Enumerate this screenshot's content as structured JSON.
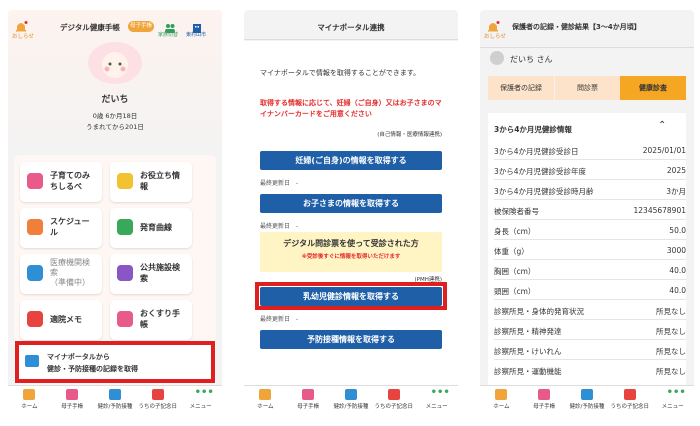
{
  "colors": {
    "accent_orange": "#f0a53a",
    "brand_blue": "#1f5fa8",
    "alert_red": "#e52b2b",
    "tab_active": "#f5a623"
  },
  "screen1": {
    "notice_label": "おしらせ",
    "title": "デジタル健康手帳",
    "child_badge": "母子手帳",
    "family_label": "家族切替",
    "city_label": "東村山市",
    "child_name": "だいち",
    "age": "0歳 6か月18日",
    "days": "うまれてから201日",
    "menu": [
      {
        "label": "子育てのみ\nちしるべ",
        "icon": "bookmark-icon"
      },
      {
        "label": "お役立ち情\n報",
        "icon": "lightbulb-icon"
      },
      {
        "label": "スケジュー\nル",
        "icon": "calendar-icon"
      },
      {
        "label": "発育曲線",
        "icon": "bar-chart-icon"
      },
      {
        "label": "医療機関検\n索\n（準備中）",
        "icon": "hospital-icon"
      },
      {
        "label": "公共施設検\n索",
        "icon": "house-icon"
      },
      {
        "label": "適院メモ",
        "icon": "memo-icon"
      },
      {
        "label": "おくすり手\n帳",
        "icon": "pill-icon"
      }
    ],
    "mynaportal_line1": "マイナポータルから",
    "mynaportal_line2": "健診・予防接種の記録を取得"
  },
  "screen2": {
    "title": "マイナポータル連携",
    "intro": "マイナポータルで情報を取得することができます。",
    "warning": "取得する情報に応じて、妊婦（ご自身）又はお子さまのマイナンバーカードをご用意ください",
    "note": "(自己情報・医療情報連携)",
    "btn_pregnant": "妊婦(ご自身)の情報を取得する",
    "last_updated": "最終更新日　-",
    "btn_child": "お子さまの情報を取得する",
    "banner_title": "デジタル問診票を使って受診された方",
    "banner_sub": "※受診後すぐに情報を取得いただけます",
    "banner_note": "(PMH連携)",
    "btn_infant": "乳幼児健診情報を取得する",
    "btn_vaccine": "予防接種情報を取得する"
  },
  "screen3": {
    "notice_label": "おしらせ",
    "title": "保護者の記録・健診結果【3～4か月頃】",
    "user": "だいち さん",
    "tabs": [
      "保護者の記録",
      "問診票",
      "健康診査"
    ],
    "section": "3から4か月児健診情報",
    "rows": [
      {
        "k": "3から4か月児健診受診日",
        "v": "2025/01/01"
      },
      {
        "k": "3から4か月児健診受診年度",
        "v": "2025"
      },
      {
        "k": "3から4か月児健診受診時月齢",
        "v": "3か月"
      },
      {
        "k": "被保険者番号",
        "v": "12345678901"
      },
      {
        "k": "身長（cm）",
        "v": "50.0"
      },
      {
        "k": "体重（g）",
        "v": "3000"
      },
      {
        "k": "胸囲（cm）",
        "v": "40.0"
      },
      {
        "k": "頭囲（cm）",
        "v": "40.0"
      },
      {
        "k": "診察所見・身体的発育状況",
        "v": "所見なし"
      },
      {
        "k": "診察所見・精神発達",
        "v": "所見なし"
      },
      {
        "k": "診察所見・けいれん",
        "v": "所見なし"
      },
      {
        "k": "診察所見・運動機能",
        "v": "所見なし"
      }
    ]
  },
  "bottom_nav": [
    {
      "label": "ホーム",
      "icon": "home-icon"
    },
    {
      "label": "母子手帳",
      "icon": "handbook-icon"
    },
    {
      "label": "健診/予防接種",
      "icon": "calendar-icon"
    },
    {
      "label": "うちの子記念日",
      "icon": "cake-icon"
    },
    {
      "label": "メニュー",
      "icon": "more-icon"
    }
  ]
}
